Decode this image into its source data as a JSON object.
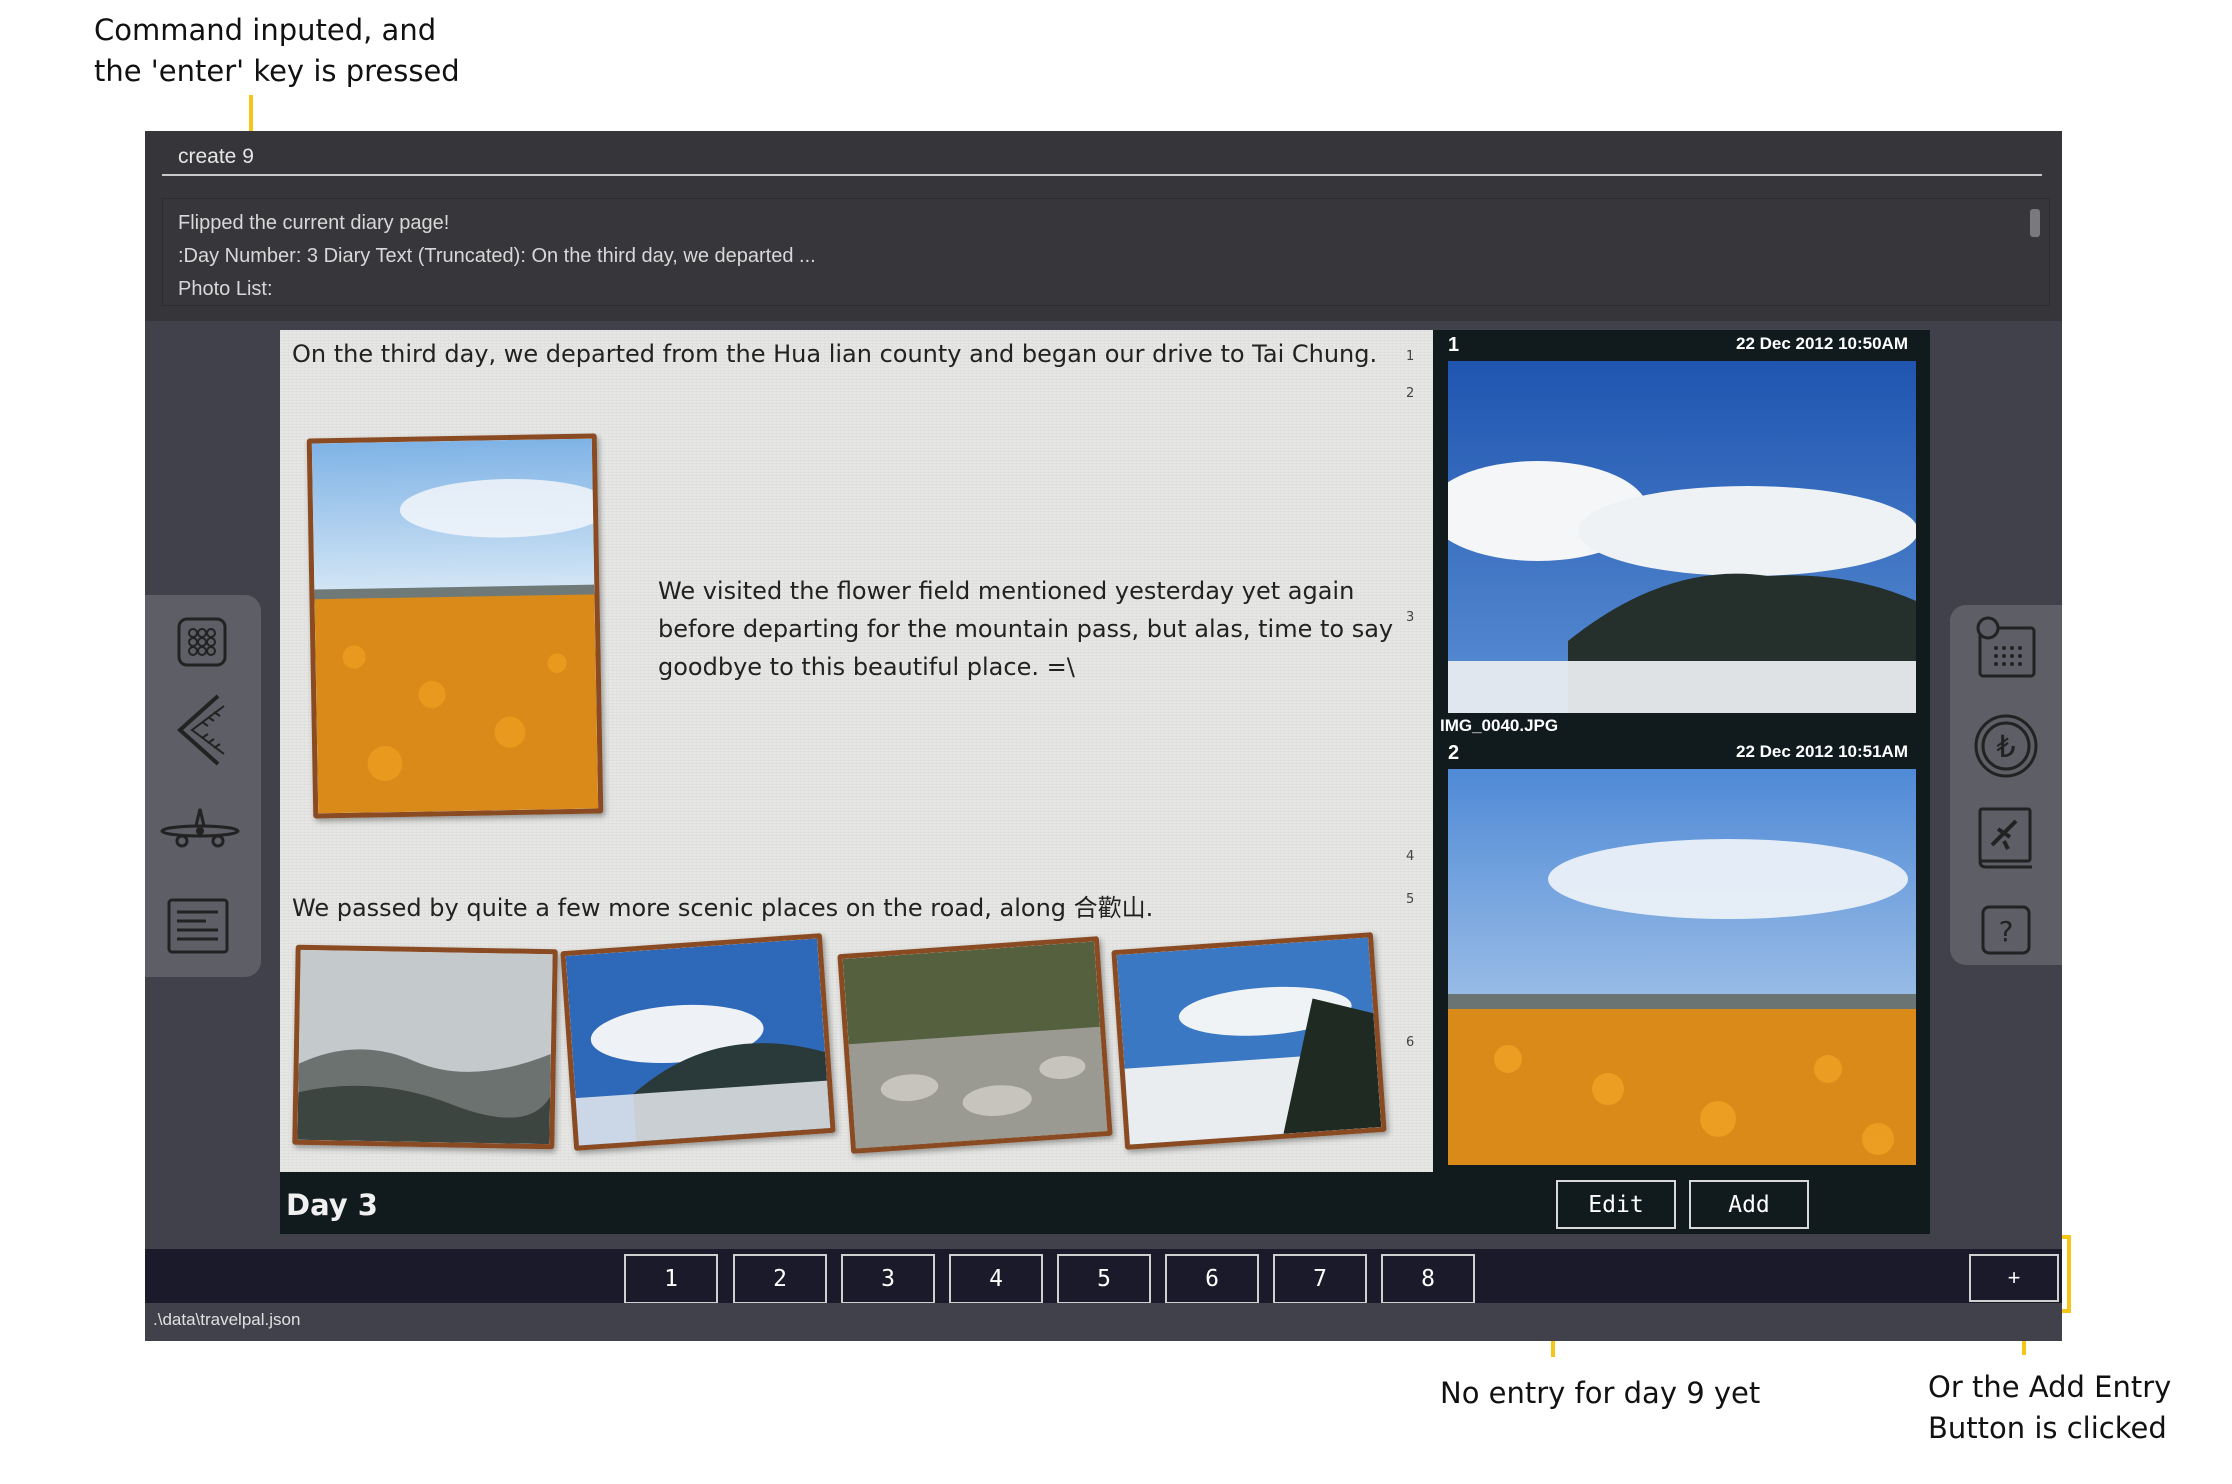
{
  "annotations": {
    "command": "Command inputed, and\nthe 'enter' key is pressed",
    "no_entry": "No entry for day 9 yet",
    "add_button": "Or the Add Entry\nButton is clicked"
  },
  "colors": {
    "highlight": "#f5c518",
    "frame": "#8a4a22",
    "window": "#41414b"
  },
  "command_box": {
    "value": "create 9"
  },
  "result_display": {
    "lines": [
      "Flipped the current diary page!",
      ":Day Number: 3 Diary Text (Truncated): On the third day, we departed ...",
      "Photo List:"
    ]
  },
  "sidebar_left": {
    "icons": [
      "grid-menu-icon",
      "back-chevron-icon",
      "airplane-icon",
      "diary-list-icon"
    ]
  },
  "sidebar_right": {
    "icons": [
      "calendar-icon",
      "currency-icon",
      "travel-book-icon",
      "help-icon"
    ]
  },
  "diary": {
    "title": "Day 3",
    "paragraphs": [
      "On the third day, we departed from the Hua lian county and began our drive to Tai Chung.",
      "We visited the flower field mentioned yesterday yet again before departing for the mountain pass, but alas, time to say goodbye to this beautiful place. =\\",
      "We passed by quite a few more scenic places on the road, along 合歡山."
    ],
    "line_numbers": [
      "1",
      "2",
      "3",
      "4",
      "5",
      "6"
    ]
  },
  "photo_list": [
    {
      "index": "1",
      "date": "22 Dec 2012 10:50AM",
      "name": "IMG_0040.JPG"
    },
    {
      "index": "2",
      "date": "22 Dec 2012 10:51AM",
      "name": ""
    }
  ],
  "photo_buttons": {
    "edit": "Edit",
    "add": "Add"
  },
  "day_buttons": [
    "1",
    "2",
    "3",
    "4",
    "5",
    "6",
    "7",
    "8"
  ],
  "add_entry_button": "+",
  "status_bar": {
    "path": ".\\data\\travelpal.json"
  }
}
